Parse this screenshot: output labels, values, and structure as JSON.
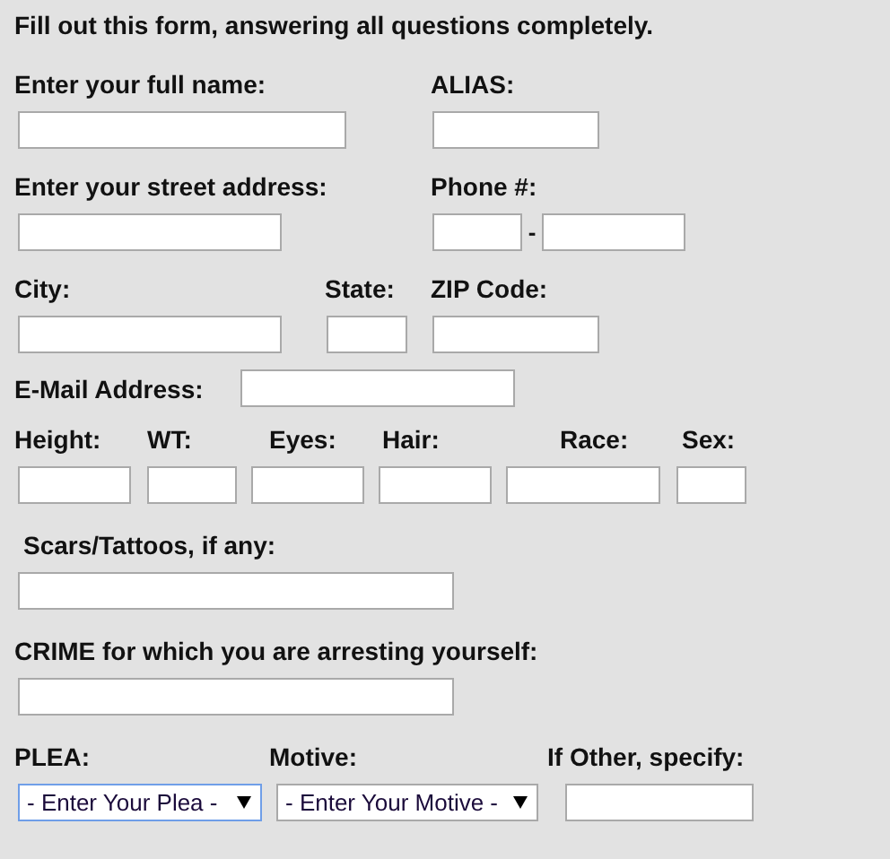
{
  "instruction": "Fill out this form, answering all questions completely.",
  "rows": [
    {
      "kind": "stacked",
      "fields": [
        {
          "label": "Enter your full name:",
          "control": {
            "kind": "text"
          }
        },
        {
          "label": "ALIAS:",
          "control": {
            "kind": "text"
          }
        }
      ]
    },
    {
      "kind": "stacked",
      "fields": [
        {
          "label": "Enter your street address:",
          "control": {
            "kind": "text"
          }
        },
        {
          "label": "Phone #:",
          "control": {
            "kind": "phone",
            "separator": "-"
          }
        }
      ]
    },
    {
      "kind": "stacked",
      "fields": [
        {
          "label": "City:",
          "control": {
            "kind": "text"
          }
        },
        {
          "label": "State:",
          "control": {
            "kind": "text"
          }
        },
        {
          "label": "ZIP Code:",
          "control": {
            "kind": "text"
          }
        }
      ]
    },
    {
      "kind": "inline",
      "fields": [
        {
          "label": "E-Mail Address:",
          "control": {
            "kind": "text"
          }
        }
      ]
    },
    {
      "kind": "stacked",
      "fields": [
        {
          "label": "Height:",
          "control": {
            "kind": "text"
          }
        },
        {
          "label": "WT:",
          "control": {
            "kind": "text"
          }
        },
        {
          "label": "Eyes:",
          "control": {
            "kind": "text"
          }
        },
        {
          "label": "Hair:",
          "control": {
            "kind": "text"
          }
        },
        {
          "label": "Race:",
          "control": {
            "kind": "text"
          }
        },
        {
          "label": "Sex:",
          "control": {
            "kind": "text"
          }
        }
      ]
    },
    {
      "kind": "stacked",
      "fields": [
        {
          "label": "Scars/Tattoos, if any:",
          "control": {
            "kind": "text"
          }
        }
      ]
    },
    {
      "kind": "stacked",
      "fields": [
        {
          "label": "CRIME for which you are arresting yourself:",
          "control": {
            "kind": "text"
          }
        }
      ]
    },
    {
      "kind": "stacked",
      "fields": [
        {
          "label": "PLEA:",
          "control": {
            "kind": "select",
            "value": "- Enter Your Plea -",
            "focused": true
          }
        },
        {
          "label": "Motive:",
          "control": {
            "kind": "select",
            "value": "- Enter Your Motive -",
            "focused": false
          }
        },
        {
          "label": "If Other, specify:",
          "control": {
            "kind": "text"
          }
        }
      ]
    }
  ]
}
